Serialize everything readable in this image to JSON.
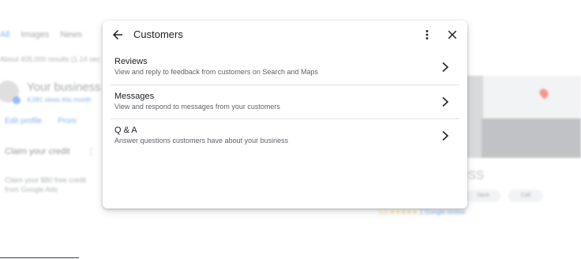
{
  "background": {
    "tabs": [
      "All",
      "Images",
      "News"
    ],
    "results_text": "About 405,000 results (1.14 sec",
    "business_title": "Your business o",
    "views_text": "4,081 views this month",
    "edit_profile": "Edit profile",
    "promote": "Prom",
    "credit_title": "Claim your credit",
    "credit_desc": "Claim your $80 free credit from Google Ads",
    "side_title": "ess",
    "side_buttons": [
      "Save",
      "Call"
    ],
    "rating_stars": "5.0 ★★★★★",
    "rating_text": "1 Google review"
  },
  "dialog": {
    "title": "Customers",
    "items": [
      {
        "title": "Reviews",
        "description": "View and reply to feedback from customers on Search and Maps"
      },
      {
        "title": "Messages",
        "description": "View and respond to messages from your customers"
      },
      {
        "title": "Q & A",
        "description": "Answer questions customers have about your business"
      }
    ]
  },
  "icons": {
    "back": "arrow-back-icon",
    "more": "more-vert-icon",
    "close": "close-icon",
    "chevron": "chevron-right-icon"
  },
  "colors": {
    "text_primary": "#202124",
    "text_secondary": "#5f6368",
    "divider": "#e0e0e0",
    "accent": "#1a73e8"
  }
}
